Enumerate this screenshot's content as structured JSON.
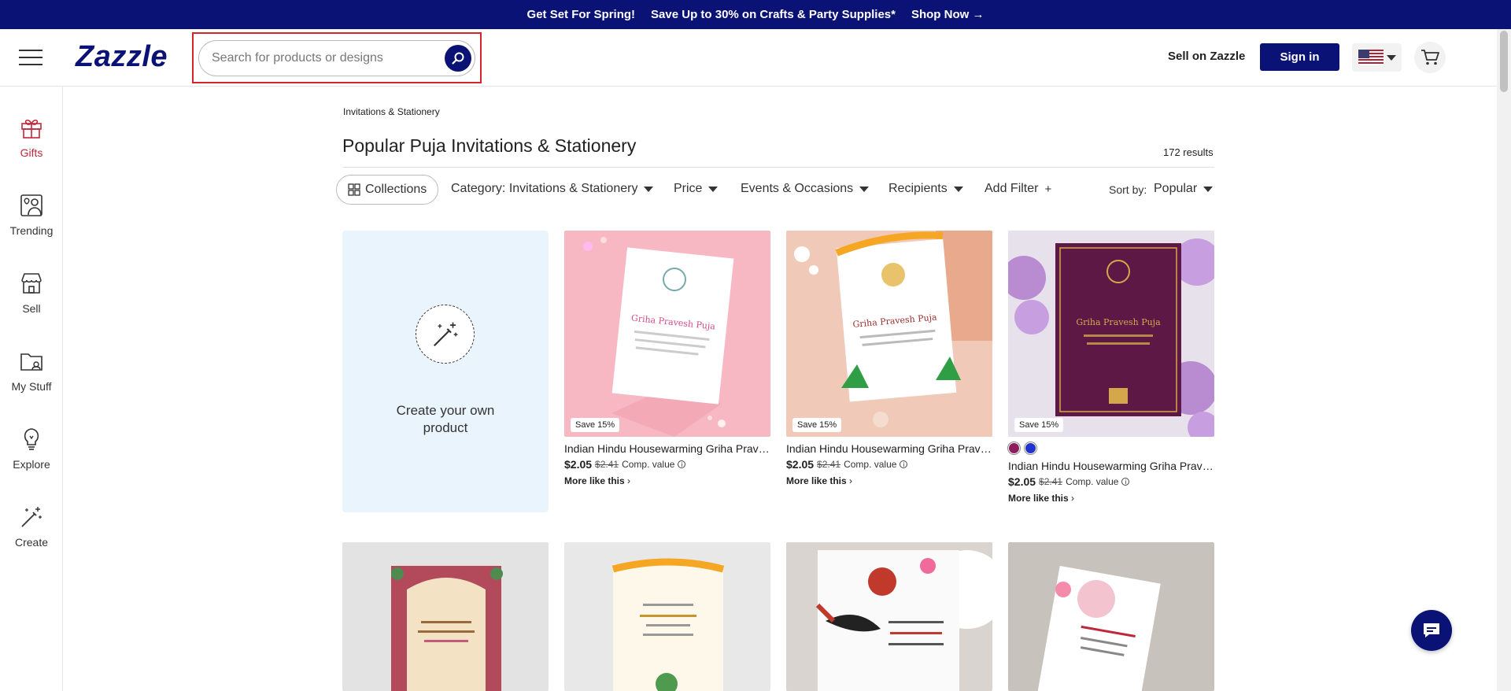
{
  "promo": {
    "part1": "Get Set For Spring!",
    "part2": "Save Up to 30% on Crafts & Party Supplies*",
    "cta": "Shop Now →"
  },
  "header": {
    "logo": "Zazzle",
    "search_placeholder": "Search for products or designs",
    "sell_link": "Sell on Zazzle",
    "signin": "Sign in"
  },
  "sidebar": {
    "items": [
      {
        "label": "Gifts",
        "icon": "gift-icon"
      },
      {
        "label": "Trending",
        "icon": "trending-icon"
      },
      {
        "label": "Sell",
        "icon": "store-icon"
      },
      {
        "label": "My Stuff",
        "icon": "folder-icon"
      },
      {
        "label": "Explore",
        "icon": "lightbulb-icon"
      },
      {
        "label": "Create",
        "icon": "wand-icon"
      }
    ]
  },
  "page": {
    "breadcrumb": "Invitations & Stationery",
    "title": "Popular Puja Invitations & Stationery",
    "results": "172 results"
  },
  "filters": {
    "collections": "Collections",
    "category": "Category: Invitations & Stationery",
    "price": "Price",
    "events": "Events & Occasions",
    "recipients": "Recipients",
    "add_filter": "Add Filter",
    "add_symbol": "+",
    "sort_label": "Sort by:",
    "sort_value": "Popular"
  },
  "create_card": {
    "line1": "Create your own",
    "line2": "product"
  },
  "products": [
    {
      "title": "Indian Hindu Housewarming Griha Prave...",
      "price": "$2.05",
      "orig": "$2.41",
      "comp": "Comp. value",
      "save": "Save 15%",
      "more": "More like this"
    },
    {
      "title": "Indian Hindu Housewarming Griha Prave...",
      "price": "$2.05",
      "orig": "$2.41",
      "comp": "Comp. value",
      "save": "Save 15%",
      "more": "More like this"
    },
    {
      "title": "Indian Hindu Housewarming Griha Prave...",
      "price": "$2.05",
      "orig": "$2.41",
      "comp": "Comp. value",
      "save": "Save 15%",
      "more": "More like this"
    }
  ],
  "colors": {
    "brand": "#0b1275",
    "accent_red": "#c0263a",
    "swatch1": "#8e1c5e",
    "swatch2": "#2233cc"
  }
}
